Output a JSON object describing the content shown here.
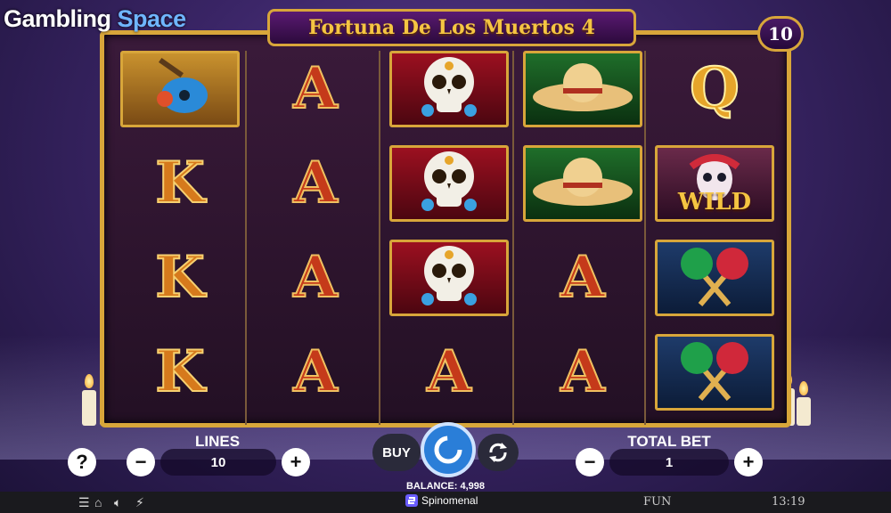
{
  "watermark": {
    "part1": "Gambling",
    "part2": "Space"
  },
  "game": {
    "title": "Fortuna De Los Muertos 4",
    "lines_badge": "10"
  },
  "reels": [
    [
      {
        "symbol": "guitar",
        "kind": "image",
        "bg": "gold"
      },
      {
        "symbol": "K",
        "kind": "letter"
      },
      {
        "symbol": "K",
        "kind": "letter"
      },
      {
        "symbol": "K",
        "kind": "letter"
      }
    ],
    [
      {
        "symbol": "A",
        "kind": "letter"
      },
      {
        "symbol": "A",
        "kind": "letter"
      },
      {
        "symbol": "A",
        "kind": "letter"
      },
      {
        "symbol": "A",
        "kind": "letter"
      }
    ],
    [
      {
        "symbol": "skull",
        "kind": "image",
        "bg": "red"
      },
      {
        "symbol": "skull",
        "kind": "image",
        "bg": "red"
      },
      {
        "symbol": "skull",
        "kind": "image",
        "bg": "red"
      },
      {
        "symbol": "A",
        "kind": "letter"
      }
    ],
    [
      {
        "symbol": "sombrero",
        "kind": "image",
        "bg": "green"
      },
      {
        "symbol": "sombrero",
        "kind": "image",
        "bg": "green"
      },
      {
        "symbol": "A",
        "kind": "letter"
      },
      {
        "symbol": "A",
        "kind": "letter"
      }
    ],
    [
      {
        "symbol": "Q",
        "kind": "letter"
      },
      {
        "symbol": "wild",
        "kind": "image",
        "bg": "pink",
        "label": "WILD"
      },
      {
        "symbol": "maracas",
        "kind": "image",
        "bg": "blue"
      },
      {
        "symbol": "maracas",
        "kind": "image",
        "bg": "blue"
      }
    ]
  ],
  "controls": {
    "help_label": "?",
    "lines_label": "LINES",
    "lines_value": "10",
    "minus": "−",
    "plus": "+",
    "buy_label": "BUY",
    "total_bet_label": "TOTAL BET",
    "total_bet_value": "1",
    "balance_text": "BALANCE: 4,998"
  },
  "status_bar": {
    "brand": "Spinomenal",
    "mode": "FUN",
    "time": "13:19"
  },
  "colors": {
    "gold": "#d8a63a",
    "spin": "#2a7ed8",
    "title": "#f5c542"
  }
}
